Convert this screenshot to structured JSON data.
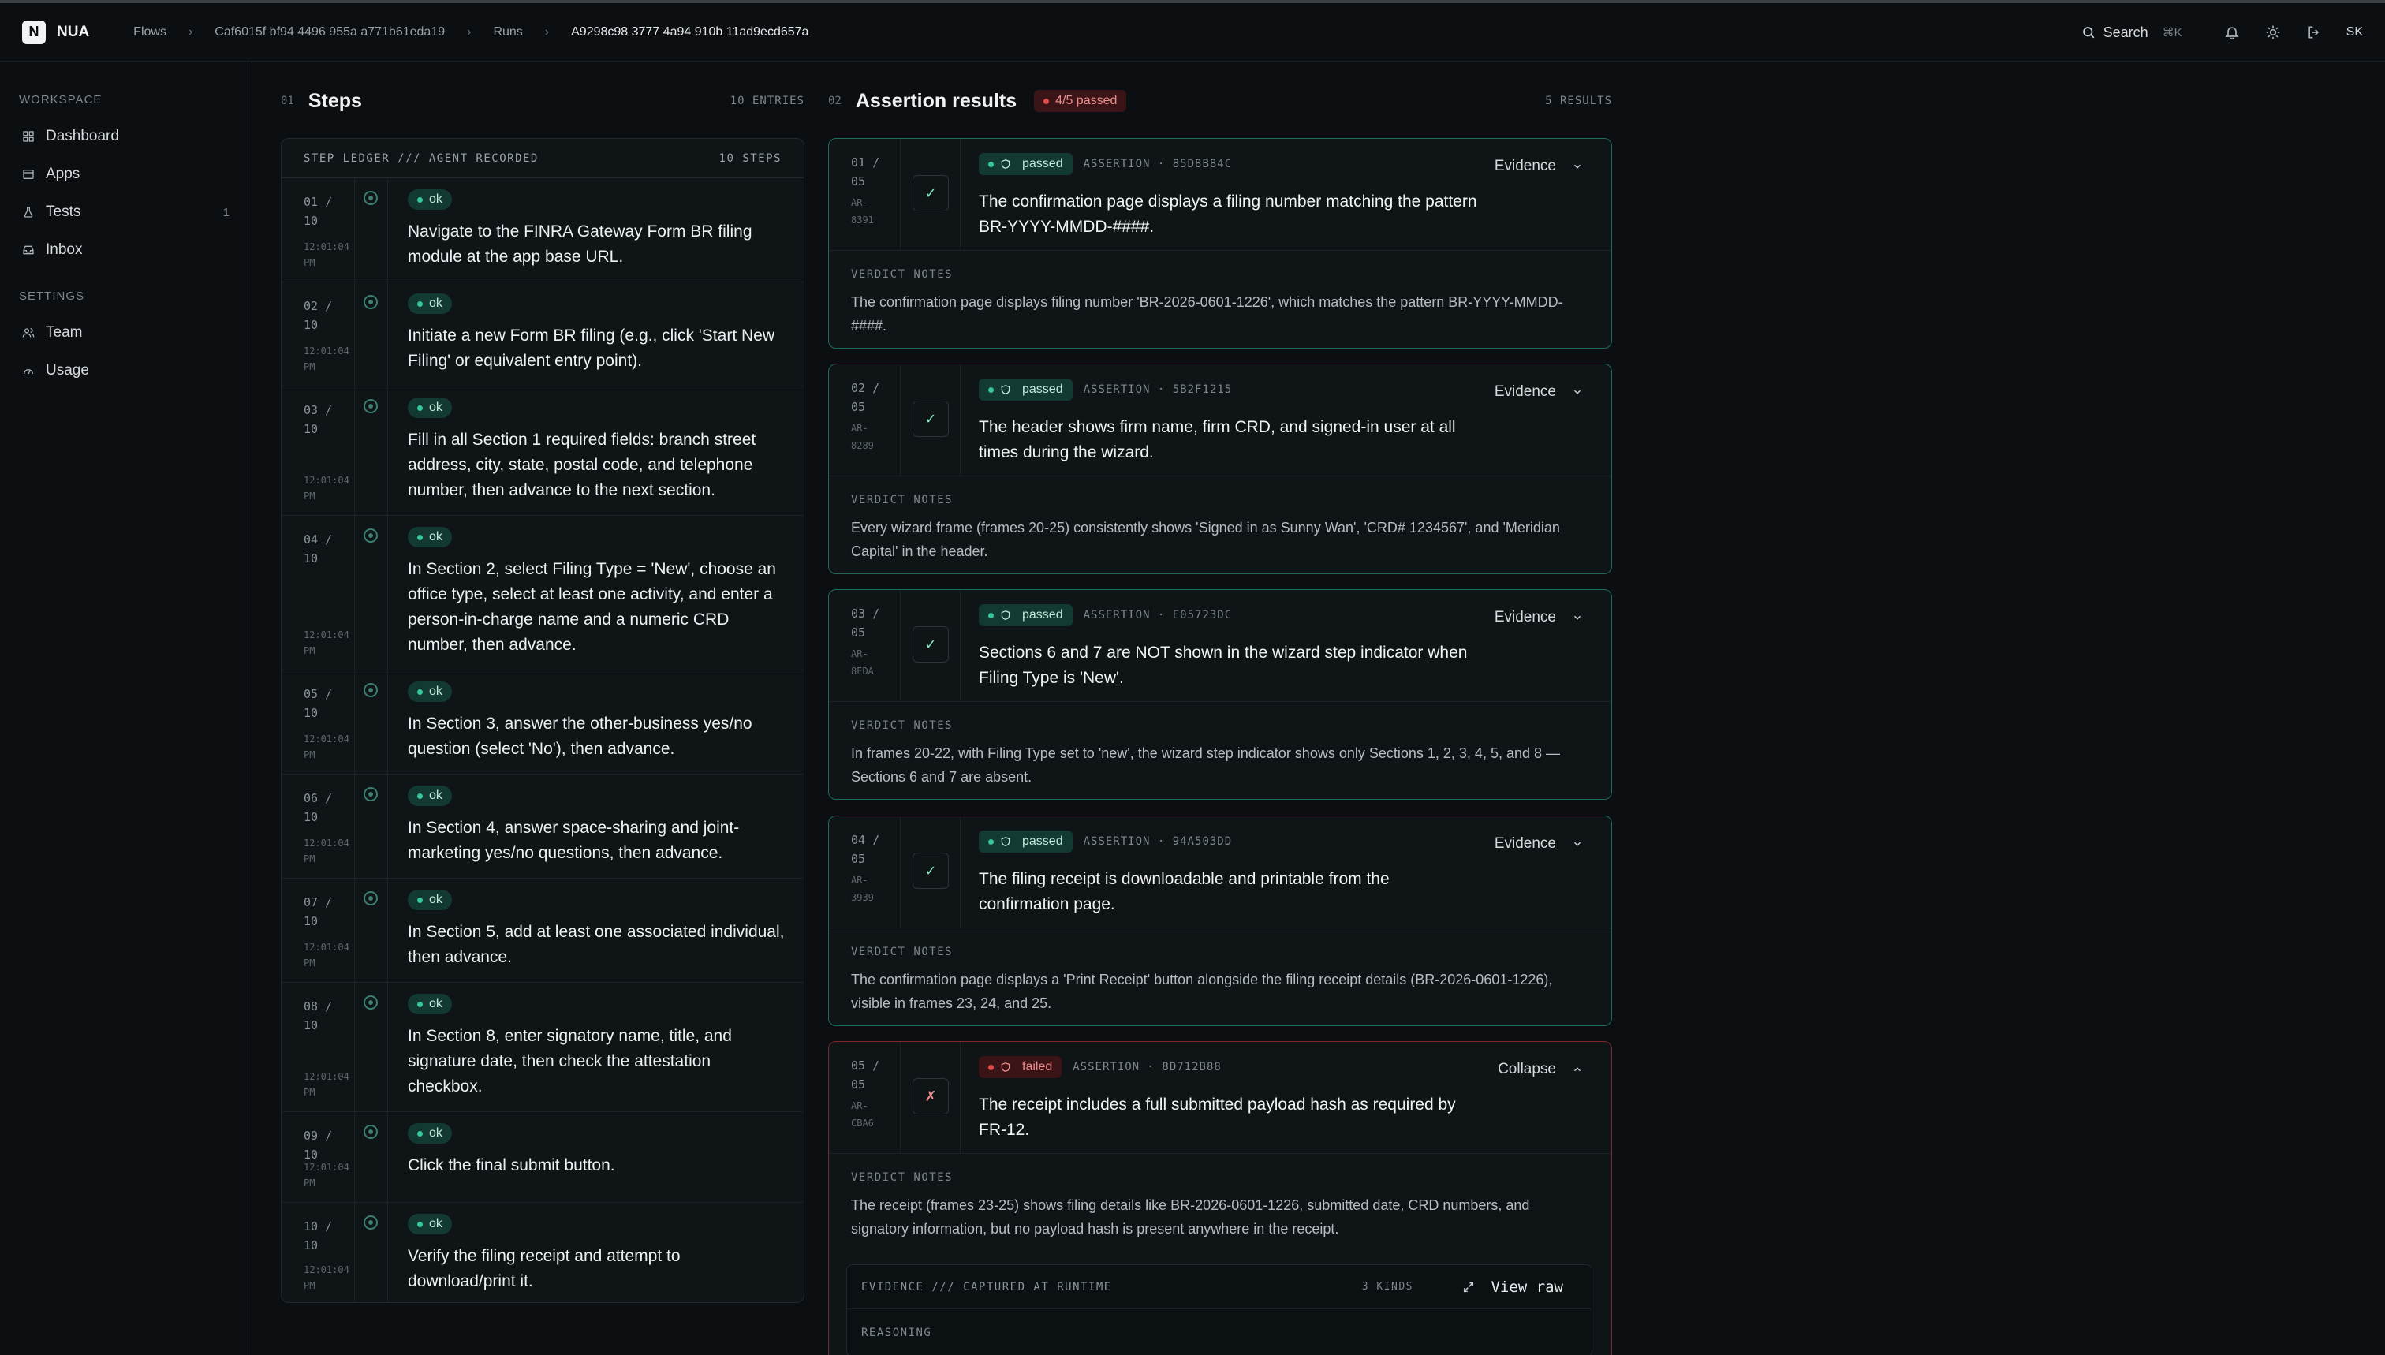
{
  "app": {
    "logo_letter": "N",
    "name": "NUA"
  },
  "breadcrumb": [
    "Flows",
    "Caf6015f bf94 4496 955a a771b61eda19",
    "Runs",
    "A9298c98 3777 4a94 910b 11ad9ecd657a"
  ],
  "search": {
    "label": "Search",
    "shortcut": "⌘K"
  },
  "user": {
    "initials": "SK"
  },
  "sidebar": {
    "workspace_label": "WORKSPACE",
    "workspace_items": [
      {
        "label": "Dashboard",
        "icon": "grid-icon"
      },
      {
        "label": "Apps",
        "icon": "window-icon"
      },
      {
        "label": "Tests",
        "icon": "flask-icon",
        "count": "1"
      },
      {
        "label": "Inbox",
        "icon": "inbox-icon"
      }
    ],
    "settings_label": "SETTINGS",
    "settings_items": [
      {
        "label": "Team",
        "icon": "users-icon"
      },
      {
        "label": "Usage",
        "icon": "gauge-icon"
      }
    ]
  },
  "steps": {
    "num": "01",
    "title": "Steps",
    "count": "10 ENTRIES",
    "ledger_title": "STEP LEDGER /// AGENT RECORDED",
    "ledger_count": "10 STEPS",
    "items": [
      {
        "idx": "01 /\n10",
        "time": "12:01:04\nPM",
        "status": "ok",
        "text": "Navigate to the FINRA Gateway Form BR filing module at the app base URL."
      },
      {
        "idx": "02 /\n10",
        "time": "12:01:04\nPM",
        "status": "ok",
        "text": "Initiate a new Form BR filing (e.g., click 'Start New Filing' or equivalent entry point)."
      },
      {
        "idx": "03 /\n10",
        "time": "12:01:04\nPM",
        "status": "ok",
        "text": "Fill in all Section 1 required fields: branch street address, city, state, postal code, and telephone number, then advance to the next section."
      },
      {
        "idx": "04 /\n10",
        "time": "12:01:04\nPM",
        "status": "ok",
        "text": "In Section 2, select Filing Type = 'New', choose an office type, select at least one activity, and enter a person-in-charge name and a numeric CRD number, then advance."
      },
      {
        "idx": "05 /\n10",
        "time": "12:01:04\nPM",
        "status": "ok",
        "text": "In Section 3, answer the other-business yes/no question (select 'No'), then advance."
      },
      {
        "idx": "06 /\n10",
        "time": "12:01:04\nPM",
        "status": "ok",
        "text": "In Section 4, answer space-sharing and joint-marketing yes/no questions, then advance."
      },
      {
        "idx": "07 /\n10",
        "time": "12:01:04\nPM",
        "status": "ok",
        "text": "In Section 5, add at least one associated individual, then advance."
      },
      {
        "idx": "08 /\n10",
        "time": "12:01:04\nPM",
        "status": "ok",
        "text": "In Section 8, enter signatory name, title, and signature date, then check the attestation checkbox."
      },
      {
        "idx": "09 /\n10",
        "time": "12:01:04\nPM",
        "status": "ok",
        "text": "Click the final submit button."
      },
      {
        "idx": "10 /\n10",
        "time": "12:01:04\nPM",
        "status": "ok",
        "text": "Verify the filing receipt and attempt to download/print it."
      }
    ]
  },
  "assertions": {
    "num": "02",
    "title": "Assertion results",
    "badge": "4/5 passed",
    "count": "5 RESULTS",
    "notes_label": "VERDICT NOTES",
    "items": [
      {
        "idx": "01 /\n05",
        "ref": "AR-\n8391",
        "status": "passed",
        "kind": "ASSERTION · 85D8B84C",
        "mark": "✓",
        "title": "The confirmation page displays a filing number matching the pattern BR-YYYY-MMDD-####.",
        "action": "Evidence",
        "notes": "The confirmation page displays filing number 'BR-2026-0601-1226', which matches the pattern BR-YYYY-MMDD-####."
      },
      {
        "idx": "02 /\n05",
        "ref": "AR-\n8289",
        "status": "passed",
        "kind": "ASSERTION · 5B2F1215",
        "mark": "✓",
        "title": "The header shows firm name, firm CRD, and signed-in user at all times during the wizard.",
        "action": "Evidence",
        "notes": "Every wizard frame (frames 20-25) consistently shows 'Signed in as Sunny Wan', 'CRD# 1234567', and 'Meridian Capital' in the header."
      },
      {
        "idx": "03 /\n05",
        "ref": "AR-\n8EDA",
        "status": "passed",
        "kind": "ASSERTION · E05723DC",
        "mark": "✓",
        "title": "Sections 6 and 7 are NOT shown in the wizard step indicator when Filing Type is 'New'.",
        "action": "Evidence",
        "notes": "In frames 20-22, with Filing Type set to 'new', the wizard step indicator shows only Sections 1, 2, 3, 4, 5, and 8 — Sections 6 and 7 are absent."
      },
      {
        "idx": "04 /\n05",
        "ref": "AR-\n3939",
        "status": "passed",
        "kind": "ASSERTION · 94A503DD",
        "mark": "✓",
        "title": "The filing receipt is downloadable and printable from the confirmation page.",
        "action": "Evidence",
        "notes": "The confirmation page displays a 'Print Receipt' button alongside the filing receipt details (BR-2026-0601-1226), visible in frames 23, 24, and 25."
      },
      {
        "idx": "05 /\n05",
        "ref": "AR-\nCBA6",
        "status": "failed",
        "kind": "ASSERTION · 8D712B88",
        "mark": "✗",
        "title": "The receipt includes a full submitted payload hash as required by FR-12.",
        "action": "Collapse",
        "notes": "The receipt (frames 23-25) shows filing details like BR-2026-0601-1226, submitted date, CRD numbers, and signatory information, but no payload hash is present anywhere in the receipt."
      }
    ],
    "evidence": {
      "title": "EVIDENCE /// CAPTURED AT RUNTIME",
      "kinds": "3 KINDS",
      "view_raw": "View raw",
      "reasoning_label": "REASONING"
    }
  }
}
